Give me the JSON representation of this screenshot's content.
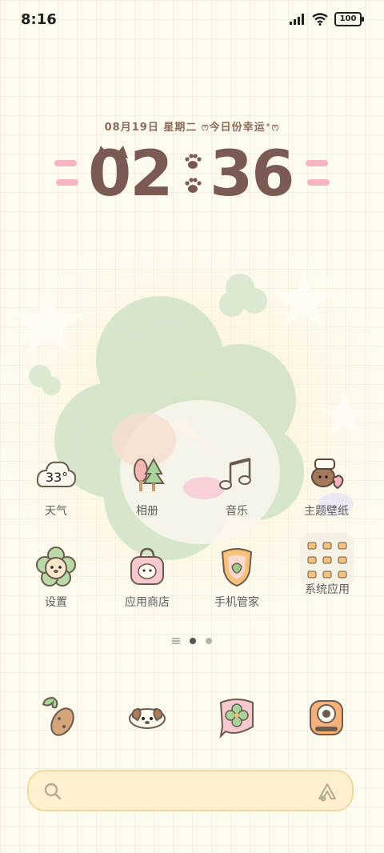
{
  "status_bar": {
    "time": "8:16",
    "battery": "100"
  },
  "lockclock": {
    "date_text": "08月19日  星期二  ෆ今日份幸运⁺ෆ",
    "hour": "02",
    "minute": "36"
  },
  "apps_row1": [
    {
      "label": "天气",
      "icon_text": "33°",
      "icon": "weather-cloud-icon"
    },
    {
      "label": "相册",
      "icon": "gallery-trees-icon"
    },
    {
      "label": "音乐",
      "icon": "music-note-icon"
    },
    {
      "label": "主题壁纸",
      "icon": "theme-dog-icon"
    }
  ],
  "apps_row2": [
    {
      "label": "设置",
      "icon": "settings-flower-dog-icon"
    },
    {
      "label": "应用商店",
      "icon": "app-store-bag-icon"
    },
    {
      "label": "手机管家",
      "icon": "security-shield-icon"
    },
    {
      "label": "系统应用",
      "icon": "system-folder-icon"
    }
  ],
  "dock": [
    {
      "name": "phone",
      "icon": "phone-peanut-icon"
    },
    {
      "name": "messages",
      "icon": "messages-dog-icon"
    },
    {
      "name": "browser",
      "icon": "browser-clover-icon"
    },
    {
      "name": "camera",
      "icon": "camera-icon"
    }
  ],
  "pager": {
    "pages": 2,
    "current": 1
  },
  "search": {
    "placeholder": ""
  },
  "colors": {
    "accent_brown": "#7a5a52",
    "accent_pink": "#f6b4c3",
    "search_bg": "#fdf0cf"
  }
}
